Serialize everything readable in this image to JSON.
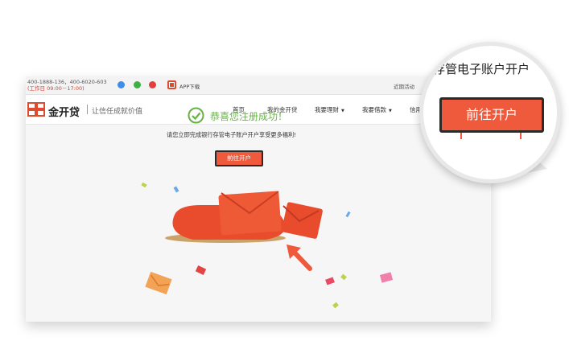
{
  "topbar": {
    "phone": "400-1888-136，400-6020-603",
    "hours_label": "工作日",
    "hours": "09:00－17:00",
    "app_download": "APP下载",
    "recent": "近期活动"
  },
  "header": {
    "logo_text": "金开贷",
    "slogan": "让信任成就价值",
    "nav": [
      "首页",
      "我的金开贷",
      "我要理财",
      "我要借款",
      "信用"
    ]
  },
  "main": {
    "success_message": "恭喜您注册成功！",
    "instruction": "请您立即完成银行存管电子账户开户享受更多福利!",
    "open_account_label": "前往开户"
  },
  "magnifier": {
    "text": "存管电子账户开户",
    "button_label": "前往开户"
  },
  "colors": {
    "accent": "#f05a3c",
    "success": "#66b245",
    "brand": "#e04a2e"
  }
}
